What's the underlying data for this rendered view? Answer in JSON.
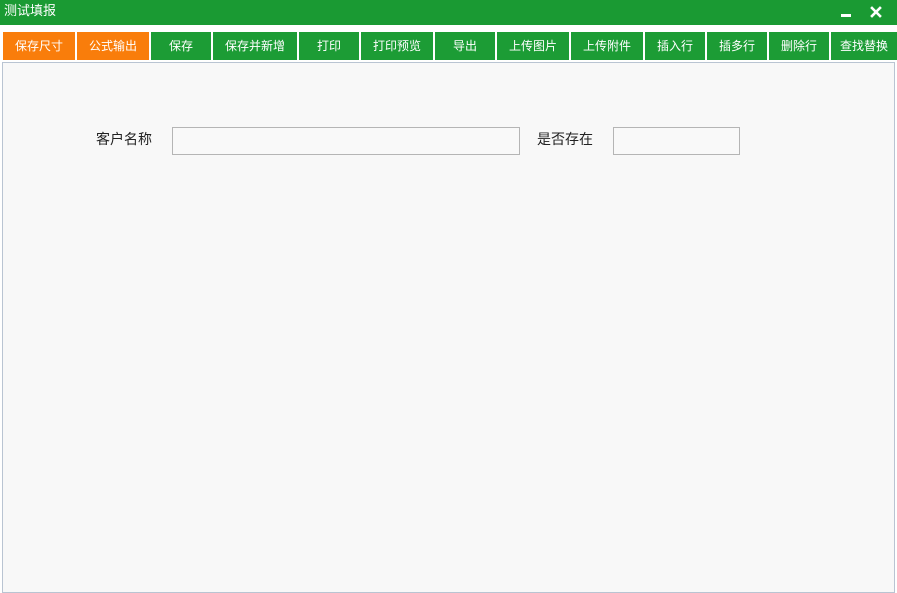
{
  "window": {
    "title": "测试填报"
  },
  "toolbar": {
    "buttons": [
      {
        "id": "save-size",
        "label": "保存尺寸"
      },
      {
        "id": "formula-output",
        "label": "公式输出"
      },
      {
        "id": "save",
        "label": "保存"
      },
      {
        "id": "save-and-new",
        "label": "保存并新增"
      },
      {
        "id": "print",
        "label": "打印"
      },
      {
        "id": "print-preview",
        "label": "打印预览"
      },
      {
        "id": "export",
        "label": "导出"
      },
      {
        "id": "upload-image",
        "label": "上传图片"
      },
      {
        "id": "upload-attachment",
        "label": "上传附件"
      },
      {
        "id": "insert-row",
        "label": "插入行"
      },
      {
        "id": "insert-multiple-rows",
        "label": "插多行"
      },
      {
        "id": "delete-row",
        "label": "删除行"
      },
      {
        "id": "find-replace",
        "label": "查找替换"
      }
    ]
  },
  "form": {
    "customer_name": {
      "label": "客户名称",
      "value": "",
      "placeholder": ""
    },
    "exists": {
      "label": "是否存在",
      "value": "",
      "placeholder": ""
    }
  },
  "colors": {
    "titlebar": "#1a9a33",
    "button_green": "#1c9c35",
    "button_orange": "#f97d0b",
    "content_bg": "#f8f8f8"
  },
  "icons": {
    "minimize": "minimize-icon",
    "close": "close-icon"
  }
}
